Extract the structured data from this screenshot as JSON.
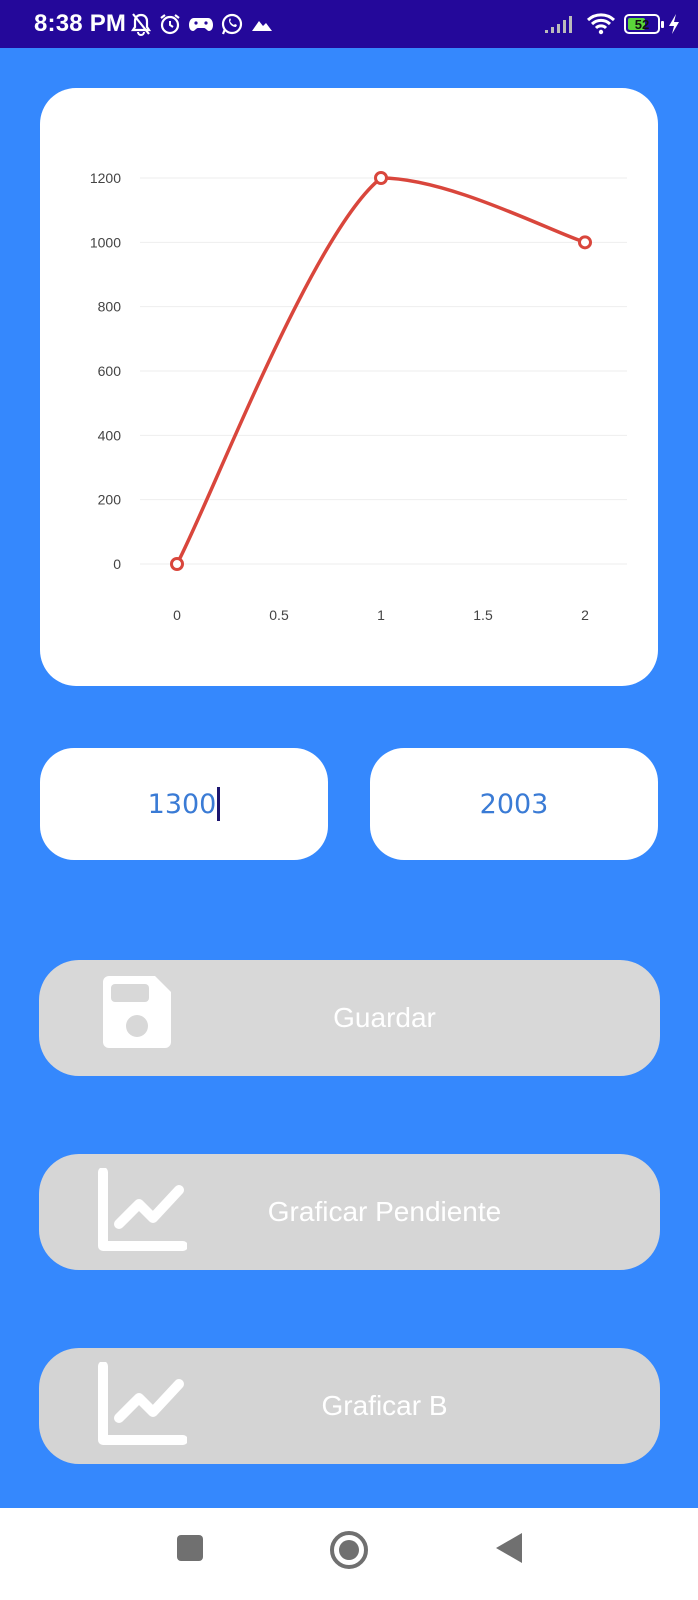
{
  "status_bar": {
    "time": "8:38 PM",
    "left_icons": [
      "bell-off-icon",
      "alarm-icon",
      "game-controller-icon",
      "whatsapp-icon",
      "mountain-icon"
    ],
    "right_icons": [
      "signal-icon",
      "wifi-icon",
      "battery-icon",
      "charging-icon"
    ],
    "battery_level": "52"
  },
  "chart_data": {
    "type": "line",
    "x": [
      0,
      1,
      2
    ],
    "series": [
      {
        "values": [
          0,
          1200,
          1000
        ],
        "color": "#d9463c"
      }
    ],
    "x_ticks": [
      "0",
      "0.5",
      "1",
      "1.5",
      "2"
    ],
    "y_ticks": [
      "0",
      "200",
      "400",
      "600",
      "800",
      "1000",
      "1200"
    ],
    "xlim": [
      0,
      2
    ],
    "ylim": [
      0,
      1200
    ],
    "grid": true,
    "smooth": true
  },
  "inputs": {
    "first_value": "1300",
    "second_value": "2003"
  },
  "buttons": {
    "save_label": "Guardar",
    "save_icon": "floppy-disk-icon",
    "slope_label": "Graficar Pendiente",
    "slope_icon": "line-chart-icon",
    "b_label": "Graficar B",
    "b_icon": "line-chart-icon"
  },
  "nav": {
    "icons": [
      "recents-square-icon",
      "home-circle-icon",
      "back-triangle-icon"
    ]
  },
  "colors": {
    "background": "#3588fd",
    "status_bar": "#24089a",
    "line": "#d9463c",
    "input_text": "#3a7bd5",
    "button_bg": "#d8d8d8"
  }
}
